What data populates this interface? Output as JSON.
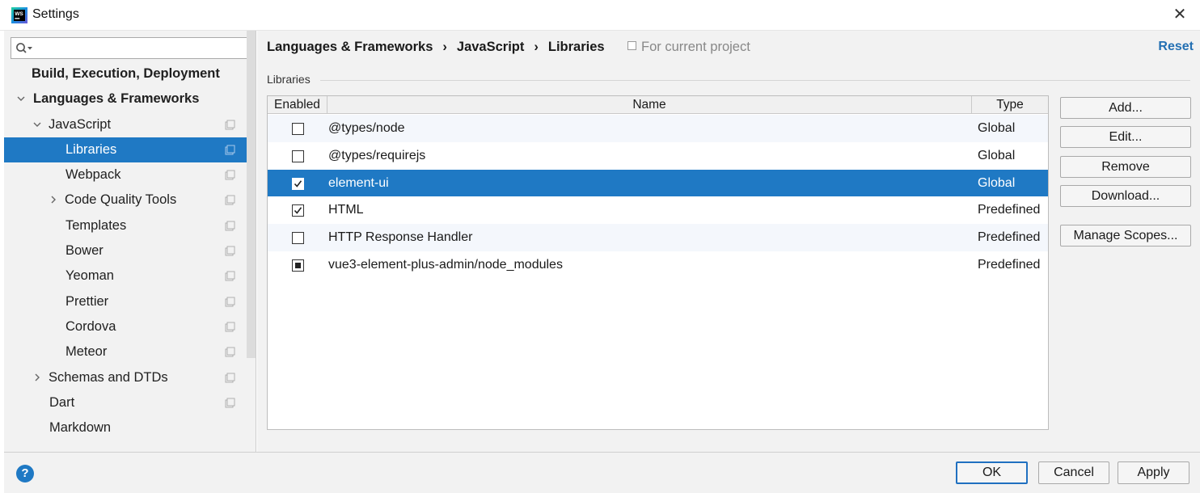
{
  "window": {
    "title": "Settings",
    "close": "✕"
  },
  "sidebar": {
    "search": {
      "value": "",
      "placeholder": ""
    },
    "items": [
      {
        "label": "Build, Execution, Deployment",
        "expandable": false
      },
      {
        "label": "Languages & Frameworks",
        "expandable": true,
        "expanded": true
      },
      {
        "label": "JavaScript",
        "expandable": true,
        "expanded": true
      },
      {
        "label": "Libraries",
        "selected": true
      },
      {
        "label": "Webpack"
      },
      {
        "label": "Code Quality Tools",
        "expandable": true,
        "expanded": false
      },
      {
        "label": "Templates"
      },
      {
        "label": "Bower"
      },
      {
        "label": "Yeoman"
      },
      {
        "label": "Prettier"
      },
      {
        "label": "Cordova"
      },
      {
        "label": "Meteor"
      },
      {
        "label": "Schemas and DTDs",
        "expandable": true,
        "expanded": false
      },
      {
        "label": "Dart"
      },
      {
        "label": "Markdown"
      }
    ]
  },
  "header": {
    "breadcrumb": [
      "Languages & Frameworks",
      "JavaScript",
      "Libraries"
    ],
    "separator": "›",
    "scope_label": "For current project",
    "reset_label": "Reset"
  },
  "section": {
    "label": "Libraries"
  },
  "table": {
    "columns": [
      "Enabled",
      "Name",
      "Type"
    ],
    "rows": [
      {
        "enabled": "unchecked",
        "name": "@types/node",
        "type": "Global"
      },
      {
        "enabled": "unchecked",
        "name": "@types/requirejs",
        "type": "Global"
      },
      {
        "enabled": "checked",
        "name": "element-ui",
        "type": "Global",
        "selected": true
      },
      {
        "enabled": "checked",
        "name": "HTML",
        "type": "Predefined"
      },
      {
        "enabled": "unchecked",
        "name": "HTTP Response Handler",
        "type": "Predefined"
      },
      {
        "enabled": "partial",
        "name": "vue3-element-plus-admin/node_modules",
        "type": "Predefined"
      }
    ]
  },
  "actions": {
    "add": "Add...",
    "edit": "Edit...",
    "remove": "Remove",
    "download": "Download...",
    "manage_scopes": "Manage Scopes..."
  },
  "footer": {
    "help": "?",
    "ok": "OK",
    "cancel": "Cancel",
    "apply": "Apply"
  },
  "colors": {
    "accent": "#1f79c4",
    "link": "#2470b3",
    "panel": "#f2f2f2",
    "alt_row": "#f4f7fc"
  }
}
